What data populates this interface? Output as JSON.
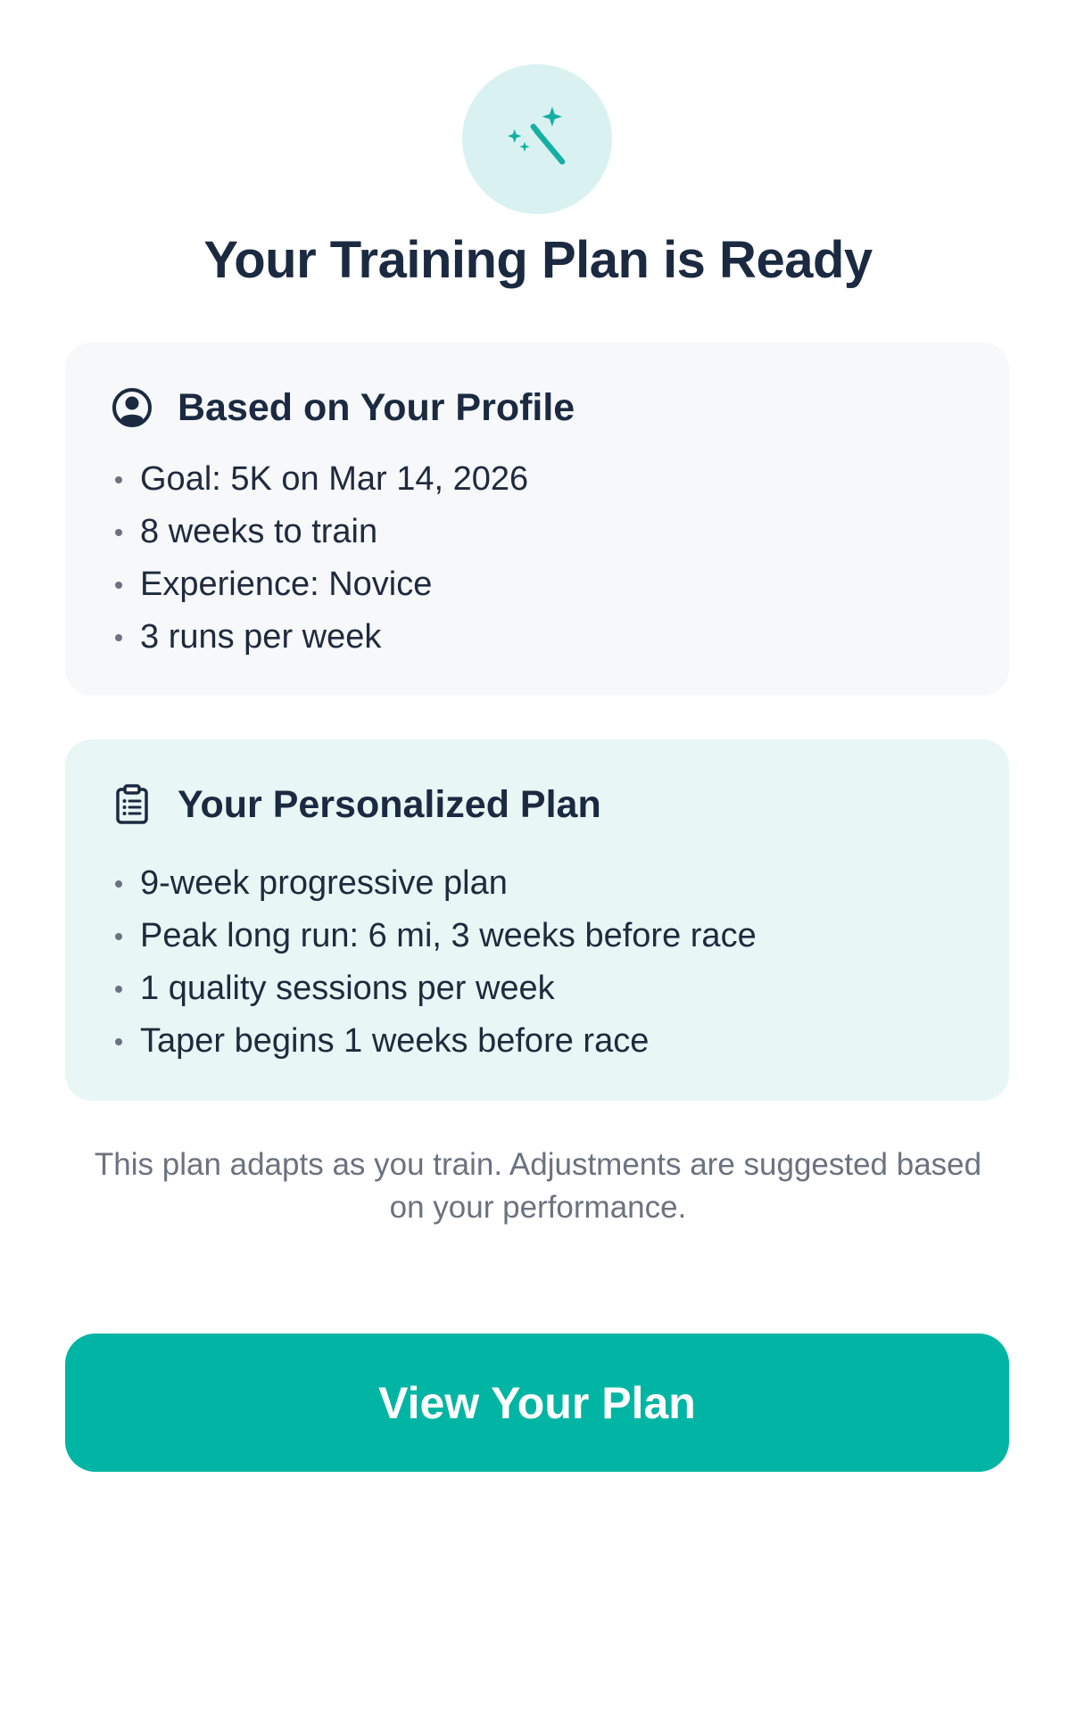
{
  "hero": {
    "icon": "magic-wand-sparkles-icon"
  },
  "title": "Your Training Plan is Ready",
  "profile_card": {
    "icon": "user-circle-icon",
    "title": "Based on Your Profile",
    "items": [
      "Goal: 5K on Mar 14, 2026",
      "8 weeks to train",
      "Experience: Novice",
      "3 runs per week"
    ]
  },
  "plan_card": {
    "icon": "clipboard-list-icon",
    "title": "Your Personalized Plan",
    "items": [
      "9-week progressive plan",
      "Peak long run: 6 mi, 3 weeks before race",
      "1 quality sessions per week",
      "Taper begins 1 weeks before race"
    ]
  },
  "footnote": "This plan adapts as you train. Adjustments are suggested based on your performance.",
  "cta_label": "View Your Plan",
  "colors": {
    "accent": "#00b5a3",
    "accent_light": "#d9f2f1",
    "plan_card_bg": "#e8f6f5",
    "profile_card_bg": "#f6f8fa",
    "text_primary": "#1b2a41",
    "text_muted": "#6b7280"
  }
}
